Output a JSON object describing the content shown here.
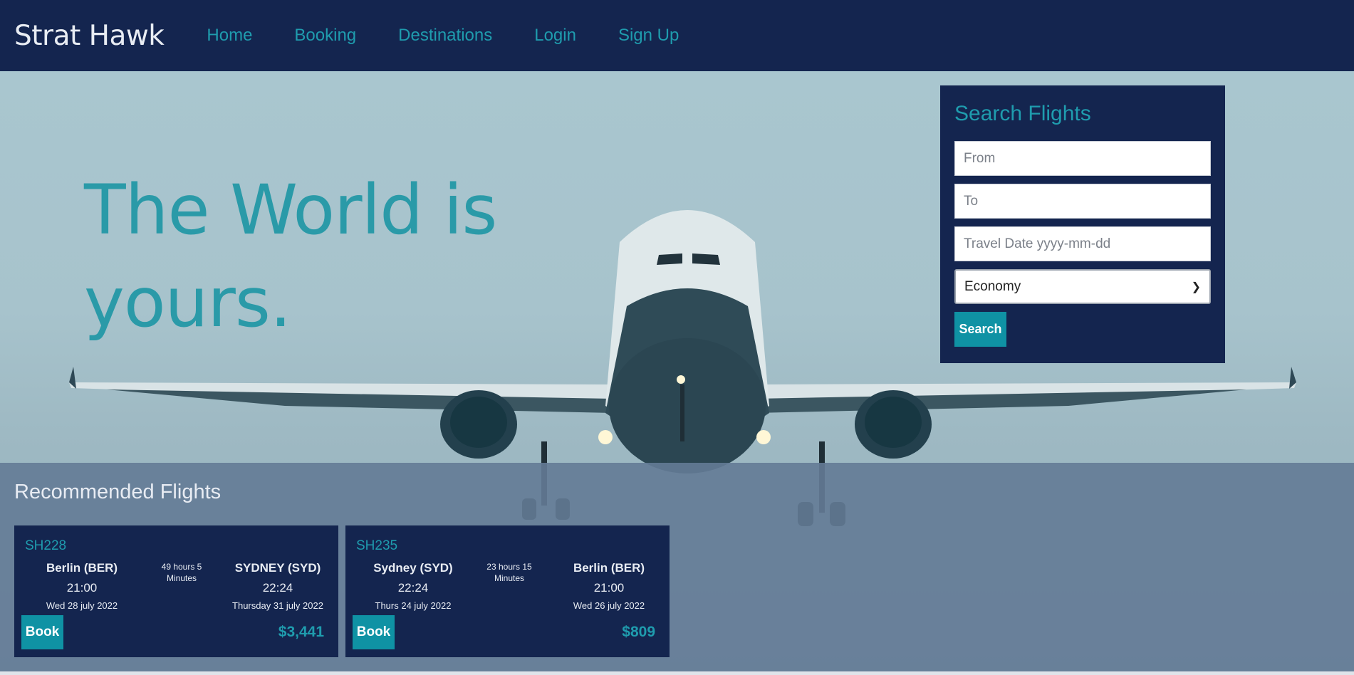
{
  "nav": {
    "brand": "Strat Hawk",
    "links": [
      "Home",
      "Booking",
      "Destinations",
      "Login",
      "Sign Up"
    ]
  },
  "hero": {
    "headline_line1": "The World is",
    "headline_line2": "yours."
  },
  "search": {
    "title": "Search Flights",
    "from_placeholder": "From",
    "to_placeholder": "To",
    "date_placeholder": "Travel Date yyyy-mm-dd",
    "class_selected": "Economy",
    "button": "Search"
  },
  "recommended": {
    "title": "Recommended Flights",
    "flights": [
      {
        "code": "SH228",
        "from_city": "Berlin (BER)",
        "from_time": "21:00",
        "from_date": "Wed 28 july 2022",
        "duration_line1": "49 hours 5",
        "duration_line2": "Minutes",
        "to_city": "SYDNEY (SYD)",
        "to_time": "22:24",
        "to_date": "Thursday 31 july 2022",
        "book": "Book",
        "price": "$3,441"
      },
      {
        "code": "SH235",
        "from_city": "Sydney (SYD)",
        "from_time": "22:24",
        "from_date": "Thurs 24 july 2022",
        "duration_line1": "23 hours 15",
        "duration_line2": "Minutes",
        "to_city": "Berlin (BER)",
        "to_time": "21:00",
        "to_date": "Wed 26 july 2022",
        "book": "Book",
        "price": "$809"
      }
    ]
  },
  "colors": {
    "navy": "#14254f",
    "teal": "#1f9cae",
    "button": "#0f92a4"
  }
}
